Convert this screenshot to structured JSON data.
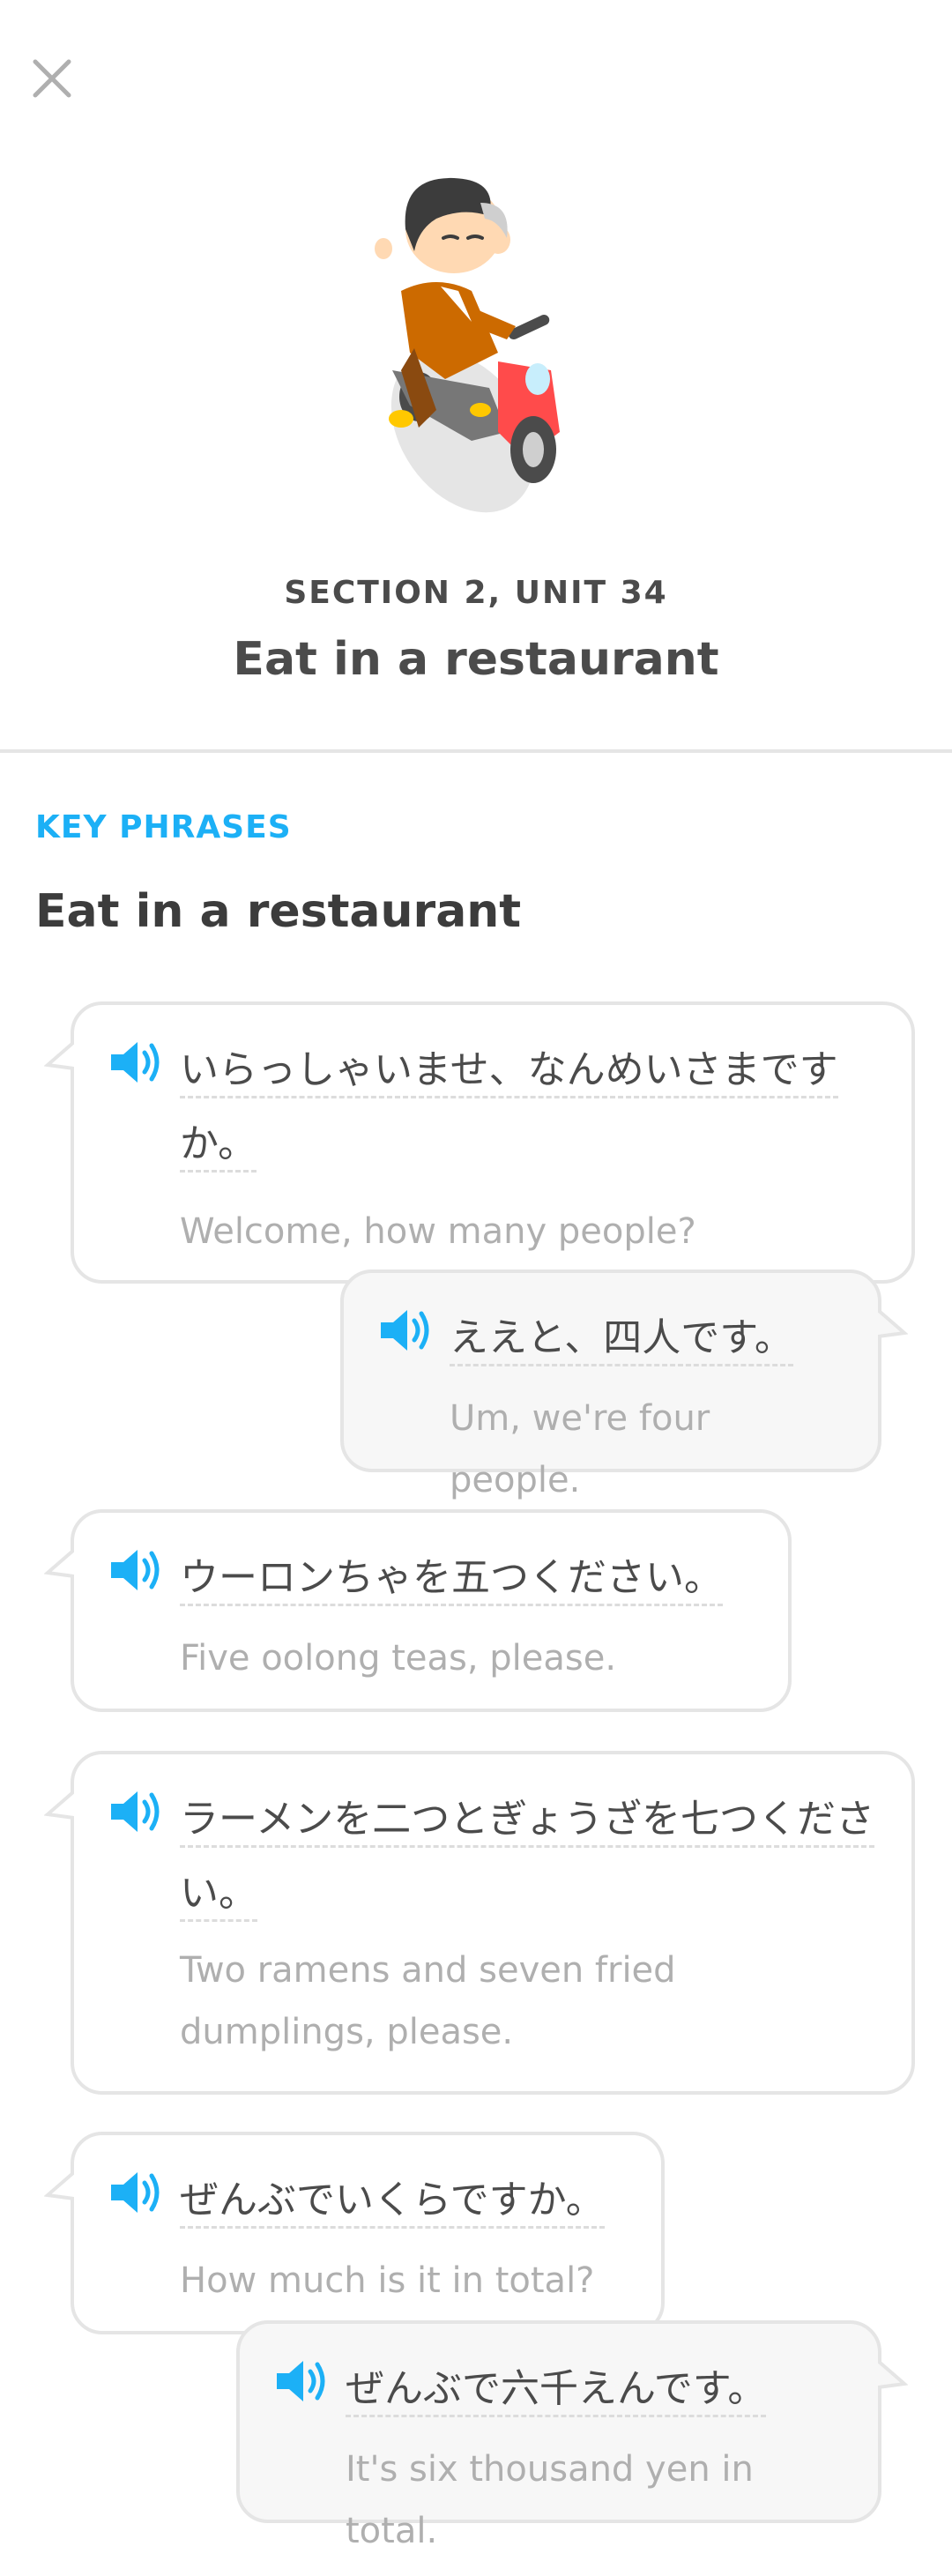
{
  "header": {
    "close_icon": "close-icon",
    "section_label": "SECTION 2, UNIT 34",
    "unit_title": "Eat in a restaurant"
  },
  "key_phrases": {
    "label": "KEY PHRASES",
    "title": "Eat in a restaurant"
  },
  "dialog": [
    {
      "side": "left",
      "japanese": "いらっしゃいませ、なんめいさまですか。",
      "english": "Welcome, how many people?"
    },
    {
      "side": "right",
      "japanese": "ええと、四人です。",
      "english": "Um, we're four people."
    },
    {
      "side": "left",
      "japanese": "ウーロンちゃを五つください。",
      "english": "Five oolong teas, please."
    },
    {
      "side": "left",
      "japanese": "ラーメンを二つとぎょうざを七つください。",
      "english": "Two ramens and seven fried dumplings, please."
    },
    {
      "side": "left",
      "japanese": "ぜんぶでいくらですか。",
      "english": "How much is it in total?"
    },
    {
      "side": "right",
      "japanese": "ぜんぶで六千えんです。",
      "english": "It's six thousand yen in total."
    }
  ],
  "colors": {
    "accent": "#1cb0f6",
    "title_text": "#4b4b4b",
    "muted_text": "#afafaf",
    "border": "#e5e5e5",
    "scooter_red": "#ff4b4b"
  }
}
